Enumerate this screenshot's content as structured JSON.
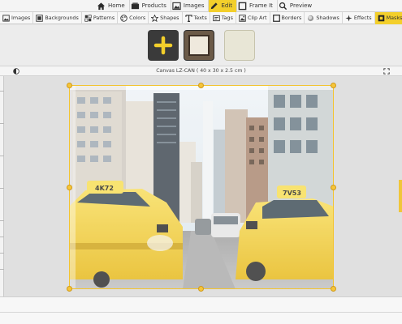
{
  "nav": {
    "items": [
      {
        "label": "Home",
        "icon": "home-icon"
      },
      {
        "label": "Products",
        "icon": "products-icon"
      },
      {
        "label": "Images",
        "icon": "images-icon"
      },
      {
        "label": "Edit",
        "icon": "pencil-icon",
        "active": true
      },
      {
        "label": "Frame It",
        "icon": "frame-icon"
      },
      {
        "label": "Preview",
        "icon": "magnifier-icon"
      }
    ]
  },
  "tools": {
    "items": [
      {
        "label": "Images",
        "icon": "images-icon"
      },
      {
        "label": "Backgrounds",
        "icon": "backgrounds-icon"
      },
      {
        "label": "Patterns",
        "icon": "patterns-icon"
      },
      {
        "label": "Colors",
        "icon": "palette-icon"
      },
      {
        "label": "Shapes",
        "icon": "star-icon"
      },
      {
        "label": "Texts",
        "icon": "text-icon"
      },
      {
        "label": "Tags",
        "icon": "tag-icon"
      },
      {
        "label": "Clip Art",
        "icon": "clipart-icon"
      },
      {
        "label": "Borders",
        "icon": "border-icon"
      },
      {
        "label": "Shadows",
        "icon": "shadow-icon"
      },
      {
        "label": "Effects",
        "icon": "sparkle-icon"
      },
      {
        "label": "Masks",
        "icon": "mask-icon",
        "active": true
      }
    ]
  },
  "canvas": {
    "title": "Canvas LZ-CAN ( 40 x 30 x 2.5 cm )"
  },
  "photo": {
    "taxi_plates": [
      "4K72",
      "7V53"
    ]
  },
  "colors": {
    "accent": "#f3cf2b",
    "handle": "#f6c53a"
  }
}
